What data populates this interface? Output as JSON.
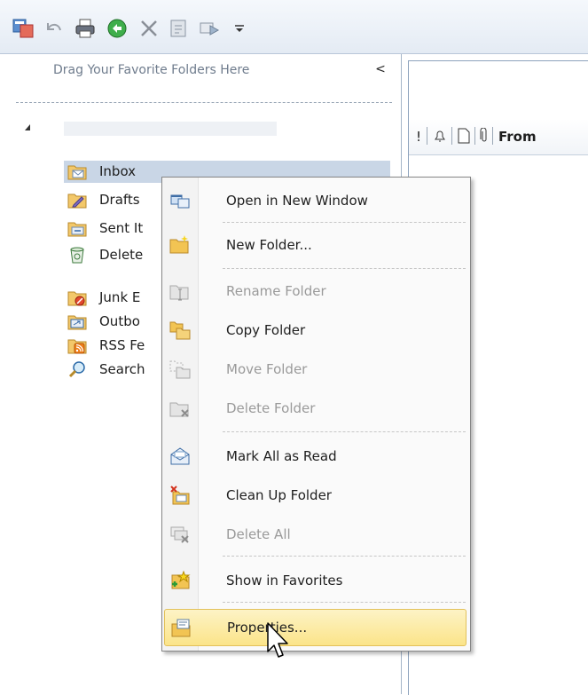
{
  "toolbar": {
    "icons": [
      "send-receive-icon",
      "undo-icon",
      "print-icon",
      "reply-icon",
      "delete-icon",
      "address-book-icon",
      "forward-icon",
      "customize-icon"
    ]
  },
  "nav": {
    "favorites_hint": "Drag Your Favorite Folders Here",
    "collapse_glyph": "<",
    "folders": [
      {
        "label": "Inbox",
        "selected": true
      },
      {
        "label": "Drafts"
      },
      {
        "label": "Sent It"
      },
      {
        "label": "Delete"
      },
      {
        "label": "Junk E"
      },
      {
        "label": "Outbo"
      },
      {
        "label": "RSS Fe"
      },
      {
        "label": "Search"
      }
    ]
  },
  "list": {
    "header": {
      "importance": "!",
      "from": "From"
    }
  },
  "menu": {
    "items": [
      {
        "label": "Open in New Window",
        "disabled": false
      },
      {
        "label": "New Folder...",
        "disabled": false
      },
      {
        "label": "Rename Folder",
        "disabled": true
      },
      {
        "label": "Copy Folder",
        "disabled": false
      },
      {
        "label": "Move Folder",
        "disabled": true
      },
      {
        "label": "Delete Folder",
        "disabled": true
      },
      {
        "label": "Mark All as Read",
        "disabled": false
      },
      {
        "label": "Clean Up Folder",
        "disabled": false
      },
      {
        "label": "Delete All",
        "disabled": true
      },
      {
        "label": "Show in Favorites",
        "disabled": false
      },
      {
        "label": "Properties...",
        "disabled": false,
        "highlighted": true
      }
    ]
  },
  "colors": {
    "selection": "#c9d6e6",
    "menu_hover": "#fbe489",
    "disabled_text": "#9a9a9a"
  }
}
